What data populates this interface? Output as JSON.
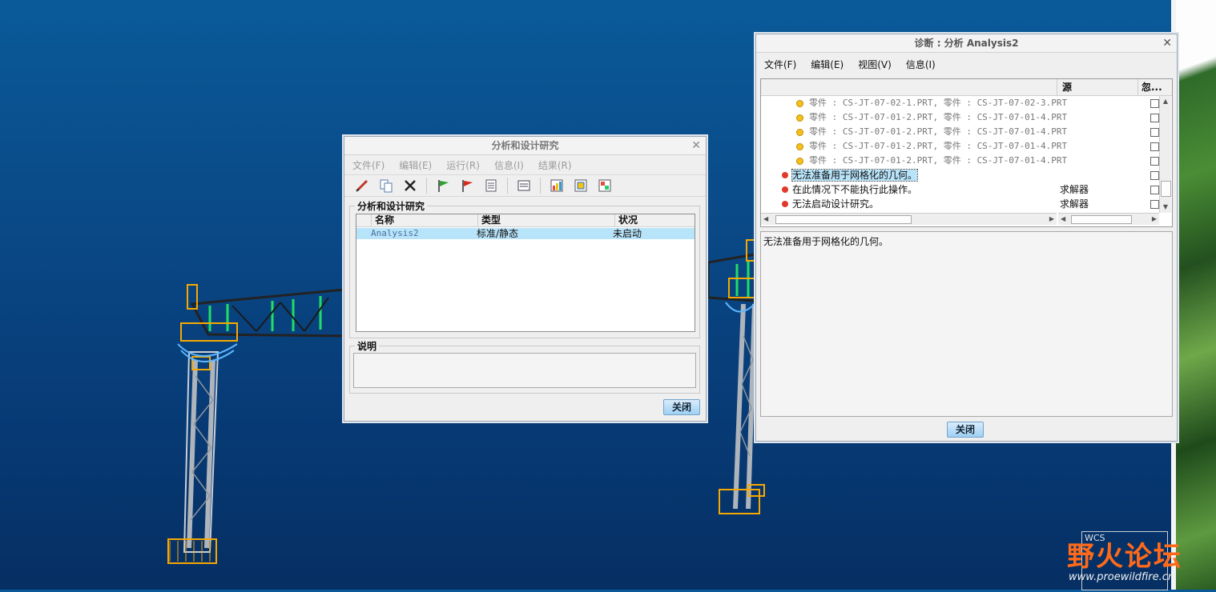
{
  "analysis_window": {
    "title": "分析和设计研究",
    "menus": [
      "文件(F)",
      "编辑(E)",
      "运行(R)",
      "信息(I)",
      "结果(R)"
    ],
    "toolbar_icons": [
      "pencil-icon",
      "copy-icon",
      "delete-icon",
      "start-flag-icon",
      "stop-flag-icon",
      "list-icon",
      "status-icon",
      "results-icon-1",
      "results-icon-2",
      "results-icon-3"
    ],
    "studies_group": "分析和设计研究",
    "columns": [
      "名称",
      "类型",
      "状况"
    ],
    "rows": [
      {
        "name": "Analysis2",
        "type": "标准/静态",
        "status": "未启动"
      }
    ],
    "description_group": "说明",
    "description": "",
    "close_label": "关闭"
  },
  "diagnostics_window": {
    "title": "诊断 : 分析 Analysis2",
    "menus": [
      "文件(F)",
      "编辑(E)",
      "视图(V)",
      "信息(I)"
    ],
    "columns": [
      "",
      "源",
      "忽..."
    ],
    "rows": [
      {
        "level": "warning",
        "text": "零件 : CS-JT-07-02-1.PRT, 零件 : CS-JT-07-02-3.PRT",
        "source": ""
      },
      {
        "level": "warning",
        "text": "零件 : CS-JT-07-01-2.PRT, 零件 : CS-JT-07-01-4.PRT",
        "source": ""
      },
      {
        "level": "warning",
        "text": "零件 : CS-JT-07-01-2.PRT, 零件 : CS-JT-07-01-4.PRT",
        "source": ""
      },
      {
        "level": "warning",
        "text": "零件 : CS-JT-07-01-2.PRT, 零件 : CS-JT-07-01-4.PRT",
        "source": ""
      },
      {
        "level": "warning",
        "text": "零件 : CS-JT-07-01-2.PRT, 零件 : CS-JT-07-01-4.PRT",
        "source": ""
      },
      {
        "level": "error",
        "text": "无法准备用于网格化的几何。",
        "source": ""
      },
      {
        "level": "error",
        "text": "在此情况下不能执行此操作。",
        "source": "求解器"
      },
      {
        "level": "error",
        "text": "无法启动设计研究。",
        "source": "求解器"
      }
    ],
    "detail_text": "无法准备用于网格化的几何。",
    "close_label": "关闭"
  },
  "watermark": {
    "brand": "野火论坛",
    "url": "www.proewildfire.cn",
    "wcs_label": "WCS"
  },
  "colors": {
    "background": "#0a4a88",
    "selection": "#b8e4fa",
    "error": "#e03a2a",
    "warning": "#f3c21a"
  }
}
